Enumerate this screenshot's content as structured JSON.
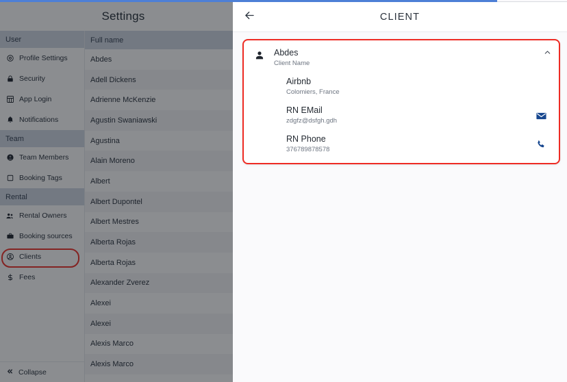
{
  "settings": {
    "title": "Settings",
    "collapse_label": "Collapse",
    "sidebar": [
      {
        "type": "section",
        "label": "User",
        "name": "sidebar-section-user"
      },
      {
        "type": "item",
        "label": "Profile Settings",
        "icon": "gear-icon",
        "name": "sidebar-item-profile-settings",
        "highlighted": false
      },
      {
        "type": "item",
        "label": "Security",
        "icon": "lock-icon",
        "name": "sidebar-item-security",
        "highlighted": false
      },
      {
        "type": "item",
        "label": "App Login",
        "icon": "app-grid-icon",
        "name": "sidebar-item-app-login",
        "highlighted": false
      },
      {
        "type": "item",
        "label": "Notifications",
        "icon": "bell-icon",
        "name": "sidebar-item-notifications",
        "highlighted": false
      },
      {
        "type": "section",
        "label": "Team",
        "name": "sidebar-section-team"
      },
      {
        "type": "item",
        "label": "Team Members",
        "icon": "person-circle-icon",
        "name": "sidebar-item-team-members",
        "highlighted": false
      },
      {
        "type": "item",
        "label": "Booking Tags",
        "icon": "tag-square-icon",
        "name": "sidebar-item-booking-tags",
        "highlighted": false
      },
      {
        "type": "section",
        "label": "Rental",
        "name": "sidebar-section-rental"
      },
      {
        "type": "item",
        "label": "Rental Owners",
        "icon": "people-icon",
        "name": "sidebar-item-rental-owners",
        "highlighted": false
      },
      {
        "type": "item",
        "label": "Booking sources",
        "icon": "briefcase-icon",
        "name": "sidebar-item-booking-sources",
        "highlighted": false
      },
      {
        "type": "item",
        "label": "Clients",
        "icon": "clients-icon",
        "name": "sidebar-item-clients",
        "highlighted": true
      },
      {
        "type": "item",
        "label": "Fees",
        "icon": "dollar-icon",
        "name": "sidebar-item-fees",
        "highlighted": false
      }
    ]
  },
  "clients_table": {
    "column_header": "Full name",
    "rows": [
      "Abdes",
      "Adell Dickens",
      "Adrienne McKenzie",
      "Agustin Swaniawski",
      "Agustina",
      "Alain Moreno",
      "Albert",
      "Albert Dupontel",
      "Albert Mestres",
      "Alberta Rojas",
      "Alberta Rojas",
      "Alexander Zverez",
      "Alexei",
      "Alexei",
      "Alexis Marco",
      "Alexis Marco"
    ]
  },
  "client_panel": {
    "back_icon": "arrow-left-icon",
    "title": "CLIENT",
    "collapse_icon": "chevron-up-icon",
    "card": {
      "avatar_icon": "person-icon",
      "fields": [
        {
          "title": "Abdes",
          "sub": "Client Name",
          "action_icon": null,
          "name": "client-name-field"
        },
        {
          "title": "Airbnb",
          "sub": "Colomiers, France",
          "action_icon": null,
          "name": "client-source-field"
        },
        {
          "title": "RN EMail",
          "sub": "zdgfz@dsfgh.gdh",
          "action_icon": "email-icon",
          "name": "client-email-field"
        },
        {
          "title": "RN Phone",
          "sub": "376789878578",
          "action_icon": "phone-icon",
          "name": "client-phone-field"
        }
      ]
    }
  },
  "colors": {
    "highlight_red": "#ee2b23",
    "action_blue": "#17478f",
    "section_bg": "#cfd6e2",
    "focus_blue": "#4d7fd6"
  }
}
